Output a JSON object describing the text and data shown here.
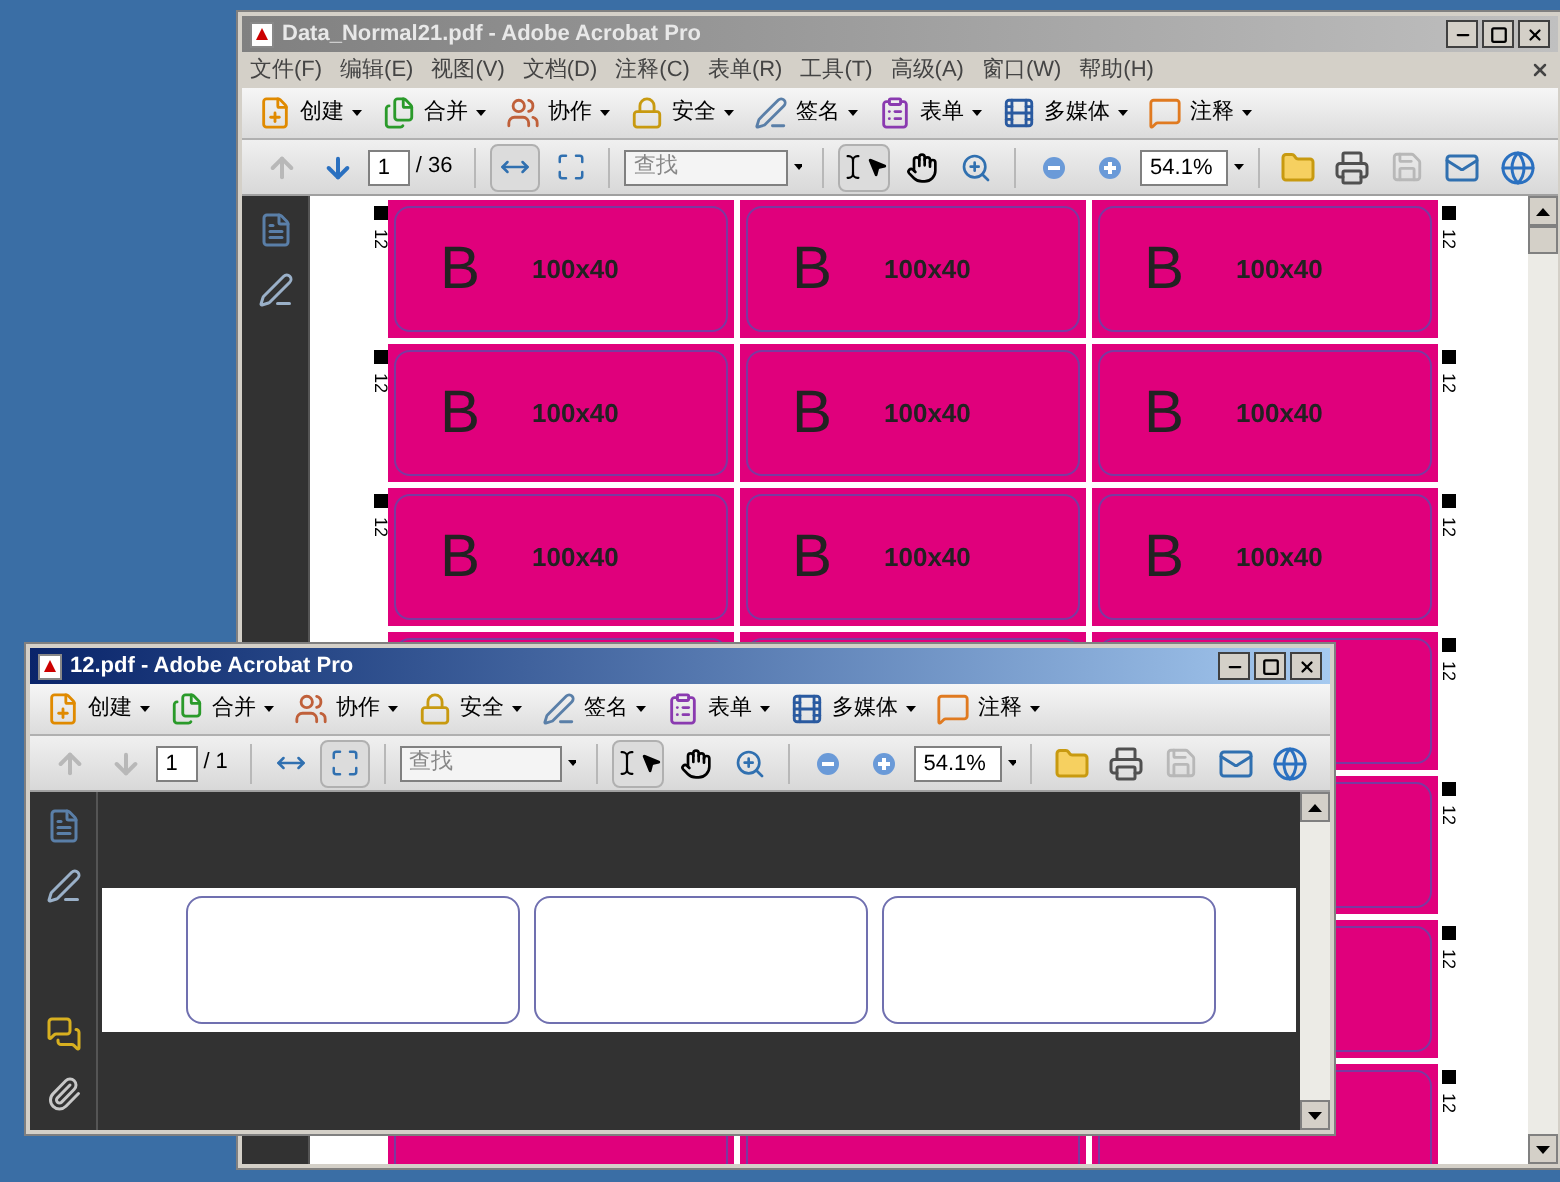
{
  "windows": [
    {
      "title": "Data_Normal21.pdf - Adobe Acrobat Pro",
      "active": false,
      "menu": [
        "文件(F)",
        "编辑(E)",
        "视图(V)",
        "文档(D)",
        "注释(C)",
        "表单(R)",
        "工具(T)",
        "高级(A)",
        "窗口(W)",
        "帮助(H)"
      ],
      "tasks": [
        "创建",
        "合并",
        "协作",
        "安全",
        "签名",
        "表单",
        "多媒体",
        "注释"
      ],
      "nav": {
        "page": "1",
        "total": "/ 36",
        "prev_disabled": true,
        "next_disabled": false
      },
      "view_buttons": [
        {
          "selected": true
        },
        {
          "selected": false
        }
      ],
      "search": {
        "placeholder": "查找"
      },
      "zoom": "54.1%",
      "side_panel": [
        {
          "kind": "pages"
        },
        {
          "kind": "signatures"
        }
      ],
      "document": {
        "kind": "sheet",
        "rows": [
          {
            "left_mark": "12",
            "right_mark": "12",
            "labels": [
              {
                "kind": "text",
                "letter": "B",
                "size": "100x40"
              },
              {
                "kind": "text",
                "letter": "B",
                "size": "100x40"
              },
              {
                "kind": "text",
                "letter": "B",
                "size": "100x40"
              }
            ]
          },
          {
            "left_mark": "12",
            "right_mark": "12",
            "labels": [
              {
                "kind": "text",
                "letter": "B",
                "size": "100x40"
              },
              {
                "kind": "text",
                "letter": "B",
                "size": "100x40"
              },
              {
                "kind": "text",
                "letter": "B",
                "size": "100x40"
              }
            ]
          },
          {
            "left_mark": "12",
            "right_mark": "12",
            "labels": [
              {
                "kind": "text",
                "letter": "B",
                "size": "100x40"
              },
              {
                "kind": "text",
                "letter": "B",
                "size": "100x40"
              },
              {
                "kind": "text",
                "letter": "B",
                "size": "100x40"
              }
            ]
          },
          {
            "right_mark": "12",
            "labels": [
              {
                "kind": "plain"
              },
              {
                "kind": "plain"
              },
              {
                "kind": "plain"
              }
            ]
          },
          {
            "right_mark": "12",
            "labels": [
              {
                "kind": "plain"
              }
            ]
          },
          {
            "right_mark": "12",
            "labels": [
              {
                "kind": "plain"
              }
            ]
          },
          {
            "right_mark": "12",
            "labels": [
              {
                "kind": "plain"
              },
              {
                "kind": "plain"
              },
              {
                "kind": "plain"
              }
            ]
          }
        ]
      }
    },
    {
      "title": "12.pdf - Adobe Acrobat Pro",
      "active": true,
      "tasks": [
        "创建",
        "合并",
        "协作",
        "安全",
        "签名",
        "表单",
        "多媒体",
        "注释"
      ],
      "nav": {
        "page": "1",
        "total": "/ 1",
        "prev_disabled": true,
        "next_disabled": true
      },
      "view_buttons": [
        {
          "selected": false
        },
        {
          "selected": true
        }
      ],
      "search": {
        "placeholder": "查找"
      },
      "zoom": "54.1%",
      "side_panel": [
        {
          "kind": "pages"
        },
        {
          "kind": "signatures"
        },
        {
          "kind": "comments"
        },
        {
          "kind": "attachments"
        }
      ],
      "document": {
        "kind": "strip",
        "boxes": [
          {
            "kind": "outline"
          },
          {
            "kind": "outline"
          },
          {
            "kind": "outline"
          }
        ]
      }
    }
  ]
}
